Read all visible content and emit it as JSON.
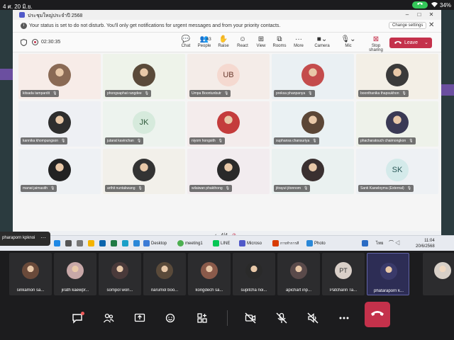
{
  "status_bar": {
    "time": "4 ศ. 20 มิ.ย.",
    "battery": "34%"
  },
  "window": {
    "title": "ประชุมใหญ่ประจำปี 2568"
  },
  "notice": {
    "message": "Your status is set to do not disturb. You'll only get notifications for urgent messages and from your priority contacts.",
    "change_settings": "Change settings"
  },
  "meeting": {
    "timer": "02:30:35",
    "tools": [
      {
        "label": "Chat",
        "icon": "chat-icon"
      },
      {
        "label": "People",
        "icon": "people-icon",
        "count": "63"
      },
      {
        "label": "Raise",
        "icon": "raise-hand-icon"
      },
      {
        "label": "React",
        "icon": "react-icon"
      },
      {
        "label": "View",
        "icon": "view-icon"
      },
      {
        "label": "Rooms",
        "icon": "rooms-icon"
      },
      {
        "label": "More",
        "icon": "more-icon"
      },
      {
        "label": "Camera",
        "icon": "camera-icon"
      },
      {
        "label": "Mic",
        "icon": "mic-icon"
      },
      {
        "label": "Stop sharing",
        "icon": "stop-sharing-icon"
      }
    ],
    "leave": "Leave"
  },
  "participants": [
    {
      "name": "kitsada tampardit",
      "initials": "",
      "bg": "#f7ece8"
    },
    {
      "name": "phongsaphat rangdee",
      "initials": "",
      "bg": "#eef3ea"
    },
    {
      "name": "Umpa Boontunbutr",
      "initials": "UB",
      "bg": "#f4ece8",
      "av_bg": "#f5d9d0",
      "av_fg": "#6a3a2e"
    },
    {
      "name": "preksa phanpanya",
      "initials": "",
      "bg": "#eaf0f3"
    },
    {
      "name": "boonthanika thapsukhon",
      "initials": "",
      "bg": "#f3efe6"
    },
    {
      "name": "kannika khompungson",
      "initials": "",
      "bg": "#eef0f4"
    },
    {
      "name": "jutarat kavinchan",
      "initials": "JK",
      "bg": "#edf3ee",
      "av_bg": "#d6eadc",
      "av_fg": "#2f5a3b"
    },
    {
      "name": "niyom hongsith",
      "initials": "",
      "bg": "#f4ecec"
    },
    {
      "name": "suphansa chansuriya",
      "initials": "",
      "bg": "#eaf1f3"
    },
    {
      "name": "phacharatouch chaimongkon",
      "initials": "",
      "bg": "#eef2ea"
    },
    {
      "name": "manat jaimasith",
      "initials": "",
      "bg": "#eef1f4"
    },
    {
      "name": "arthit nuntakwang",
      "initials": "",
      "bg": "#f2f0ea"
    },
    {
      "name": "wilaiwan phakthong",
      "initials": "",
      "bg": "#f2ecef"
    },
    {
      "name": "jitrayut jitonnom",
      "initials": "",
      "bg": "#eaf1f0"
    },
    {
      "name": "Santi Kaewloyma (External)",
      "initials": "SK",
      "bg": "#eef1f4",
      "av_bg": "#d4eaea",
      "av_fg": "#2c5a5a"
    }
  ],
  "pager": {
    "text": "4/4"
  },
  "taskbar": {
    "presenter": "pharaporn kpknoi",
    "items": [
      {
        "label": "Desktop",
        "color": "#3c7bd6"
      },
      {
        "label": "meeting1",
        "color": "#4caf50"
      },
      {
        "label": "LINE",
        "color": "#06c755"
      },
      {
        "label": "Microso",
        "color": "#5059c9"
      },
      {
        "label": "การทำการสี",
        "color": "#d83b01"
      },
      {
        "label": "Photo",
        "color": "#2b88d8"
      }
    ],
    "lang": "ไทย",
    "time": "11:04",
    "date": "20/6/2568"
  },
  "strip": [
    {
      "name": "sirikamon sa...",
      "initials": ""
    },
    {
      "name": "jirath kaewpr...",
      "initials": ""
    },
    {
      "name": "sompol won...",
      "initials": ""
    },
    {
      "name": "narumol boo...",
      "initials": ""
    },
    {
      "name": "kongdech sa...",
      "initials": ""
    },
    {
      "name": "supitcha noi...",
      "initials": ""
    },
    {
      "name": "apichart inp...",
      "initials": ""
    },
    {
      "name": "Patcharin Ta...",
      "initials": "PT"
    },
    {
      "name": "phataraporn k...",
      "initials": ""
    }
  ],
  "controls": [
    {
      "name": "chat-button",
      "icon": "chat-icon"
    },
    {
      "name": "people-button",
      "icon": "people-icon"
    },
    {
      "name": "share-button",
      "icon": "share-icon"
    },
    {
      "name": "react-button",
      "icon": "react-icon"
    },
    {
      "name": "apps-button",
      "icon": "apps-icon"
    },
    {
      "name": "camera-off-button",
      "icon": "camera-off-icon"
    },
    {
      "name": "mic-off-button",
      "icon": "mic-off-icon"
    },
    {
      "name": "speaker-off-button",
      "icon": "speaker-off-icon"
    },
    {
      "name": "more-button",
      "icon": "more-icon"
    },
    {
      "name": "end-call-button",
      "icon": "end-call-icon"
    }
  ]
}
